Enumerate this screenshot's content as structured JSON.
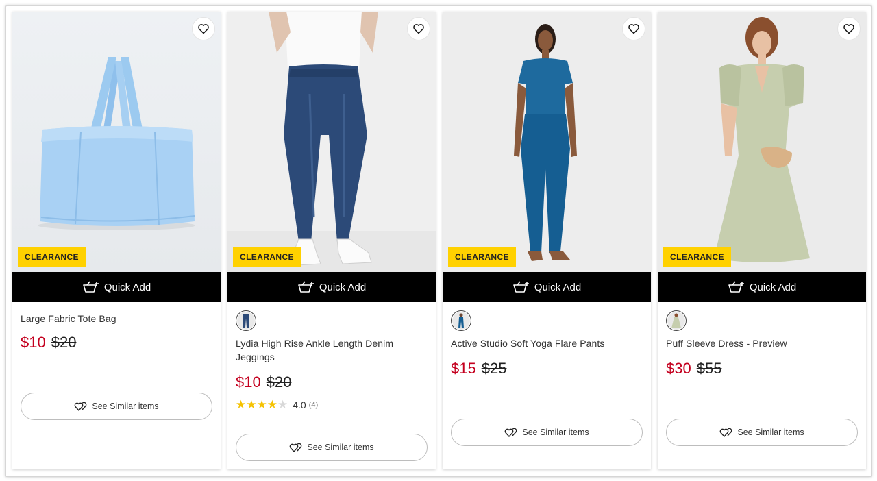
{
  "products": [
    {
      "badge": "CLEARANCE",
      "quick_add": "Quick Add",
      "name": "Large Fabric Tote Bag",
      "sale_price": "$10",
      "original_price": "$20",
      "similar": "See Similar items"
    },
    {
      "badge": "CLEARANCE",
      "quick_add": "Quick Add",
      "name": "Lydia High Rise Ankle Length Denim Jeggings",
      "sale_price": "$10",
      "original_price": "$20",
      "rating": "4.0",
      "rating_count": "(4)",
      "rating_value": 4,
      "similar": "See Similar items"
    },
    {
      "badge": "CLEARANCE",
      "quick_add": "Quick Add",
      "name": "Active Studio Soft Yoga Flare Pants",
      "sale_price": "$15",
      "original_price": "$25",
      "similar": "See Similar items"
    },
    {
      "badge": "CLEARANCE",
      "quick_add": "Quick Add",
      "name": "Puff Sleeve Dress - Preview",
      "sale_price": "$30",
      "original_price": "$55",
      "similar": "See Similar items"
    }
  ],
  "colors": {
    "sale_red": "#c4001f",
    "badge_yellow": "#ffd100",
    "quick_add_bg": "#000000",
    "star_gold": "#f5c200"
  },
  "icons": {
    "wishlist": "heart-outline-icon",
    "quick_add": "basket-plus-icon",
    "similar": "similar-hearts-icon",
    "star": "star-icon"
  }
}
